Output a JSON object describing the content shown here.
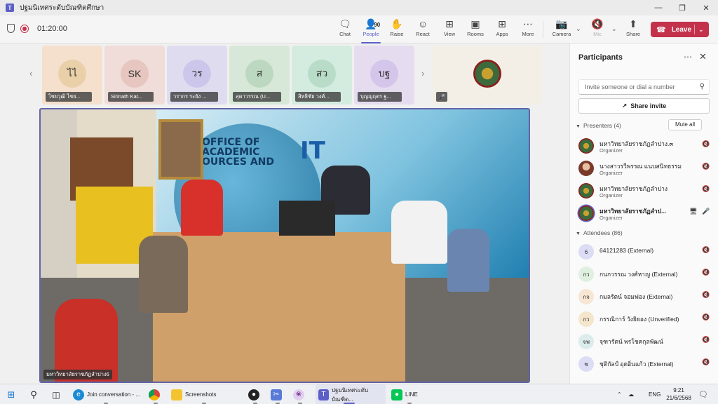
{
  "window": {
    "title": "ปฐมนิเทศระดับบัณฑิตศึกษา",
    "controls": [
      "—",
      "❐",
      "✕"
    ]
  },
  "toolbar": {
    "timer": "01:20:00",
    "people_count": "90",
    "buttons": [
      {
        "label": "Chat",
        "icon": "chat-icon"
      },
      {
        "label": "People",
        "icon": "people-icon"
      },
      {
        "label": "Raise",
        "icon": "hand-icon"
      },
      {
        "label": "React",
        "icon": "smile-icon"
      },
      {
        "label": "View",
        "icon": "grid-icon"
      },
      {
        "label": "Rooms",
        "icon": "rooms-icon"
      },
      {
        "label": "Apps",
        "icon": "plus-icon"
      },
      {
        "label": "More",
        "icon": "ellipsis-icon"
      },
      {
        "label": "Camera",
        "icon": "camera-off-icon"
      },
      {
        "label": "Mic",
        "icon": "mic-off-icon"
      },
      {
        "label": "Share",
        "icon": "share-icon"
      }
    ],
    "leave_label": "Leave"
  },
  "tiles": [
    {
      "initials": "ไไ",
      "name": "ไชยวุฒิ ไชย...",
      "color": "#f4e0cc"
    },
    {
      "initials": "SK",
      "name": "Sirinath Kat...",
      "color": "#f0dcd8"
    },
    {
      "initials": "วร",
      "name": "วรากร ระยัง ...",
      "color": "#e0dcf0"
    },
    {
      "initials": "ส",
      "name": "สุดาวรรณ (U...",
      "color": "#d8e8d8"
    },
    {
      "initials": "สว",
      "name": "สิทธิชัย วงศ์...",
      "color": "#d4ece0"
    },
    {
      "initials": "บฐ",
      "name": "บุญญฤตร ฐ...",
      "color": "#e6dcf0"
    }
  ],
  "main_video": {
    "speaker_name": "มหาวิทยาลัยราชภัฏลำปาง6",
    "sign_line1": "OFFICE OF",
    "sign_line2": "ACADEMIC",
    "sign_line3": "OURCES AND",
    "sign_it": "IT"
  },
  "panel": {
    "title": "Participants",
    "invite_placeholder": "Invite someone or dial a number",
    "share_invite": "Share invite",
    "presenters_label": "Presenters (4)",
    "mute_all": "Mute all",
    "attendees_label": "Attendees (86)",
    "presenters": [
      {
        "name": "มหาวิทยาลัยราชภัฏลำปาง.๓",
        "role": "Organizer",
        "avatar": "logo"
      },
      {
        "name": "นางสาวรวีพรรณ แนบสนิทธรรม",
        "role": "Organizer",
        "avatar": "photo"
      },
      {
        "name": "มหาวิทยาลัยราชภัฏลำปาง",
        "role": "Organizer",
        "avatar": "logo"
      },
      {
        "name": "มหาวิทยาลัยราชภัฏลำป...",
        "role": "Organizer",
        "avatar": "logo"
      }
    ],
    "attendees": [
      {
        "initials": "6",
        "name": "64121283 (External)",
        "color": "#dcdcf4"
      },
      {
        "initials": "กว",
        "name": "กนกวรรณ วงศ์หาญ (External)",
        "color": "#dff0e0"
      },
      {
        "initials": "กจ",
        "name": "กมลรัตน์ จอมฟอง (External)",
        "color": "#f8e6d4"
      },
      {
        "initials": "กว",
        "name": "กรรณิการ์ วังยิยอง (Unverified)",
        "color": "#f4e6cc"
      },
      {
        "initials": "จพ",
        "name": "จุฑารัตน์ พรโชคกุลพัฒน์",
        "color": "#dcecec"
      },
      {
        "initials": "ช",
        "name": "ชุติกัลป์ อุดอิ่นแก้ว (External)",
        "color": "#dcdcf4"
      }
    ]
  },
  "taskbar": {
    "items": [
      {
        "label": "Join conversation - ...",
        "icon": "edge-icon"
      },
      {
        "label": "Screenshots",
        "icon": "folder-icon"
      },
      {
        "label": "ปฐมนิเทศระดับบัณฑิต...",
        "icon": "teams-icon"
      },
      {
        "label": "LINE",
        "icon": "line-icon"
      }
    ],
    "language": "ENG",
    "time": "9:21",
    "date": "21/6/2568"
  },
  "colors": {
    "accent": "#5b5fc7",
    "leave": "#c4314b",
    "video_border": "#6264a7"
  }
}
